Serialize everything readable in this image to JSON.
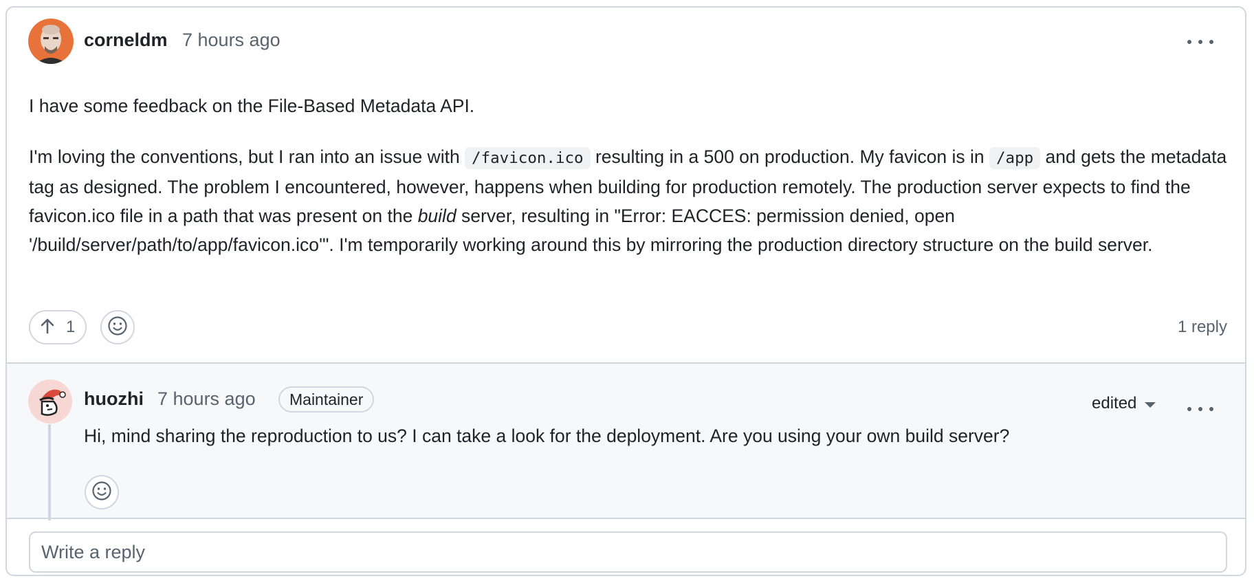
{
  "thread": {
    "post": {
      "author": "corneldm",
      "time": "7 hours ago",
      "paragraph1": "I have some feedback on the File-Based Metadata API.",
      "paragraph2": {
        "t1": "I'm loving the conventions, but I ran into an issue with ",
        "code1": "/favicon.ico",
        "t2": " resulting in a 500 on production. My favicon is in ",
        "code2": "/app",
        "t3": " and gets the metadata tag as designed. The problem I encountered, however, happens when building for production remotely. The production server expects to find the favicon.ico file in a path that was present on the ",
        "em": "build",
        "t4": " server, resulting in \"Error: EACCES: permission denied, open '/build/server/path/to/app/favicon.ico'\". I'm temporarily working around this by mirroring the production directory structure on the build server."
      },
      "upvote_count": "1",
      "reply_count": "1 reply"
    },
    "reply": {
      "author": "huozhi",
      "time": "7 hours ago",
      "badge": "Maintainer",
      "edited": "edited",
      "text": "Hi, mind sharing the reproduction to us? I can take a look for the deployment. Are you using your own build server?"
    },
    "reply_box": {
      "placeholder": "Write a reply"
    }
  },
  "icons": {
    "upvote": "arrow-up-icon",
    "reaction": "smiley-icon",
    "more": "kebab-horizontal-icon",
    "dropdown": "triangle-down-icon"
  },
  "colors": {
    "border": "#d0d7de",
    "muted_text": "#59636e",
    "reply_background": "#f6f8fa"
  }
}
